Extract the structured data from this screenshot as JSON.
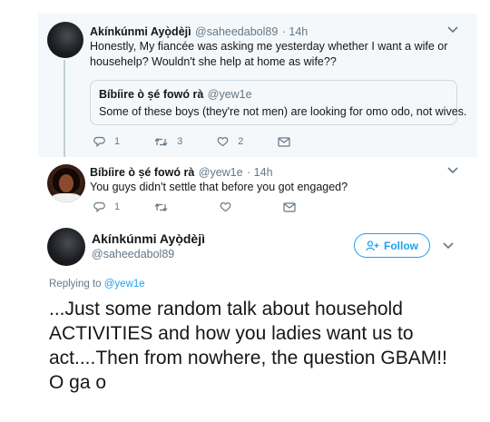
{
  "tweet_a": {
    "name": "Akínkúnmi Ayọ̀dèjì",
    "handle": "@saheedabol89",
    "time": "· 14h",
    "text": "Honestly, My fiancée was asking me yesterday whether I want a wife or househelp? Wouldn't she help at home as wife??",
    "quote": {
      "name": "Bíbíire ò ṣé fowó rà",
      "handle": "@yew1e",
      "text": "Some of these boys (they're not men) are looking for omo odo, not wives."
    },
    "reply_count": "1",
    "retweet_count": "3",
    "like_count": "2"
  },
  "tweet_b": {
    "name": "Bíbíire ò ṣé fowó rà",
    "handle": "@yew1e",
    "time": "· 14h",
    "text": "You guys didn't settle that before you got engaged?",
    "reply_count": "1"
  },
  "main_tweet": {
    "name": "Akínkúnmi Ayọ̀dèjì",
    "handle": "@saheedabol89",
    "follow_label": "Follow",
    "replying_prefix": "Replying to",
    "replying_to": "@yew1e",
    "text": "...Just some random talk about household ACTIVITIES and how you ladies want us to act....Then from nowhere, the question GBAM!! O ga o"
  },
  "colors": {
    "accent": "#1da1f2",
    "muted": "#657786",
    "thread_bg": "#f5f8fa"
  },
  "icons": {
    "reply": "reply-icon",
    "retweet": "retweet-icon",
    "like": "heart-icon",
    "dm": "mail-icon",
    "more": "chevron-down-icon",
    "follow": "add-user-icon"
  }
}
